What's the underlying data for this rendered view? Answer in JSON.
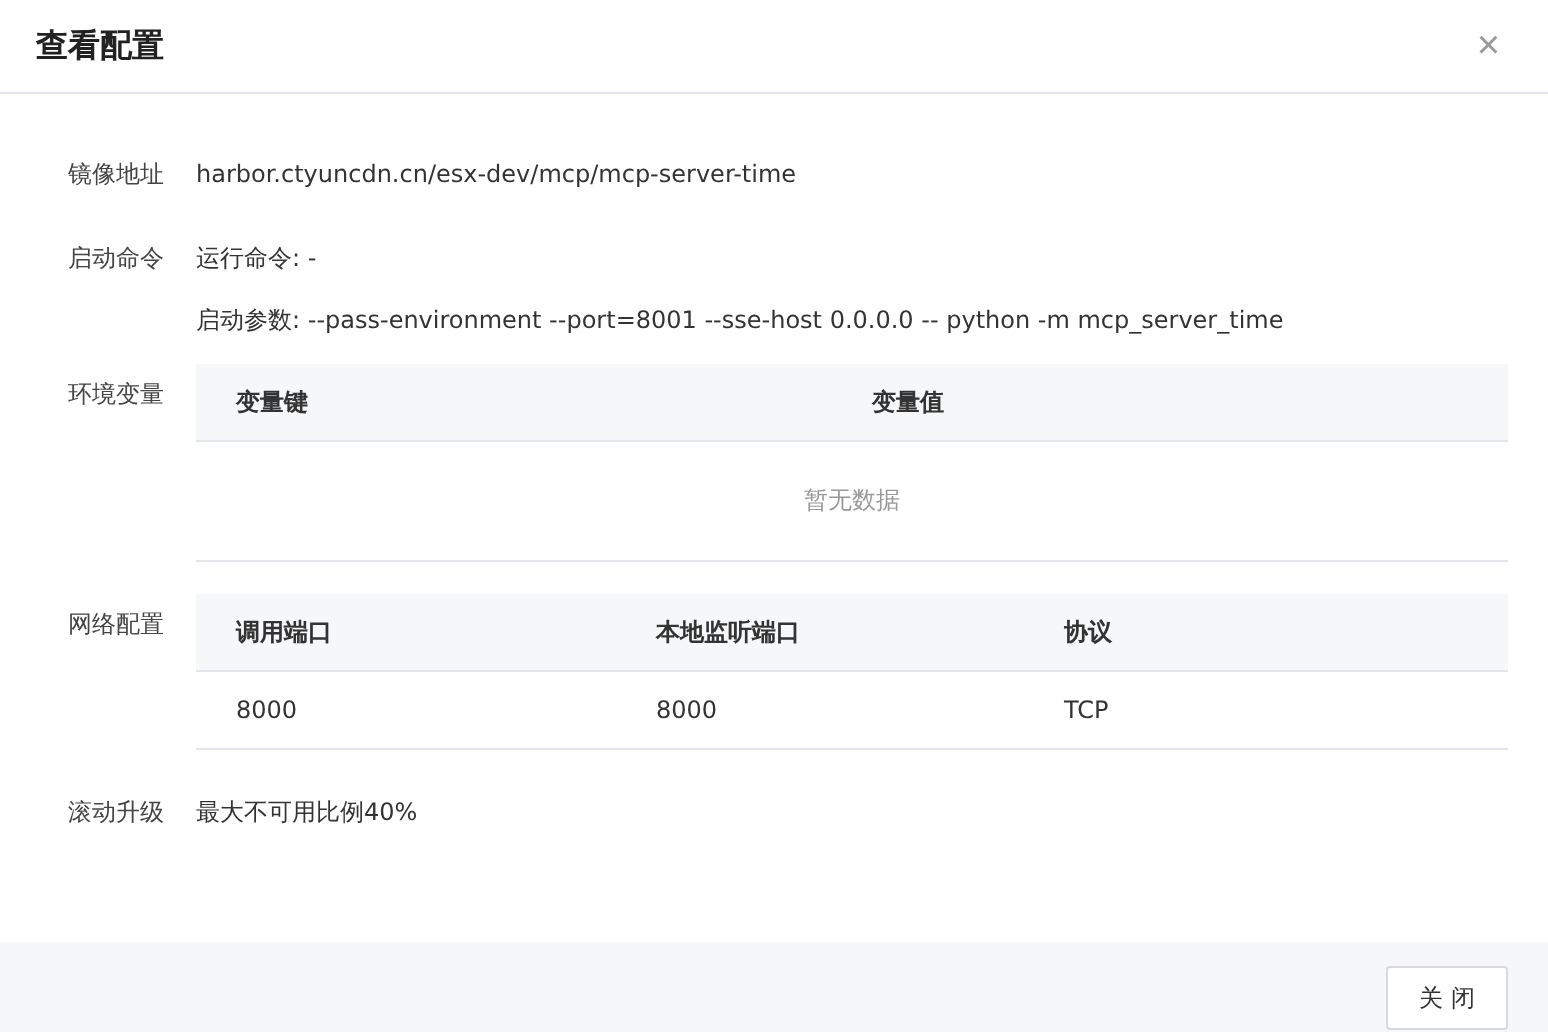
{
  "dialog": {
    "title": "查看配置",
    "close_icon": "×"
  },
  "fields": [
    {
      "kind": "text",
      "label": "镜像地址",
      "lines": [
        "harbor.ctyuncdn.cn/esx-dev/mcp/mcp-server-time"
      ]
    },
    {
      "kind": "text",
      "label": "启动命令",
      "lines": [
        "运行命令: -",
        "启动参数: --pass-environment --port=8001 --sse-host 0.0.0.0 -- python -m mcp_server_time"
      ]
    },
    {
      "kind": "table",
      "label": "环境变量",
      "columns": [
        "变量键",
        "变量值"
      ],
      "empty_text": "暂无数据"
    },
    {
      "kind": "table",
      "label": "网络配置",
      "columns": [
        "调用端口",
        "本地监听端口",
        "协议"
      ],
      "rows": [
        [
          "8000",
          "8000",
          "TCP"
        ]
      ]
    },
    {
      "kind": "text",
      "label": "滚动升级",
      "lines": [
        "最大不可用比例40%"
      ]
    }
  ],
  "footer": {
    "buttons": [
      "关 闭"
    ]
  }
}
